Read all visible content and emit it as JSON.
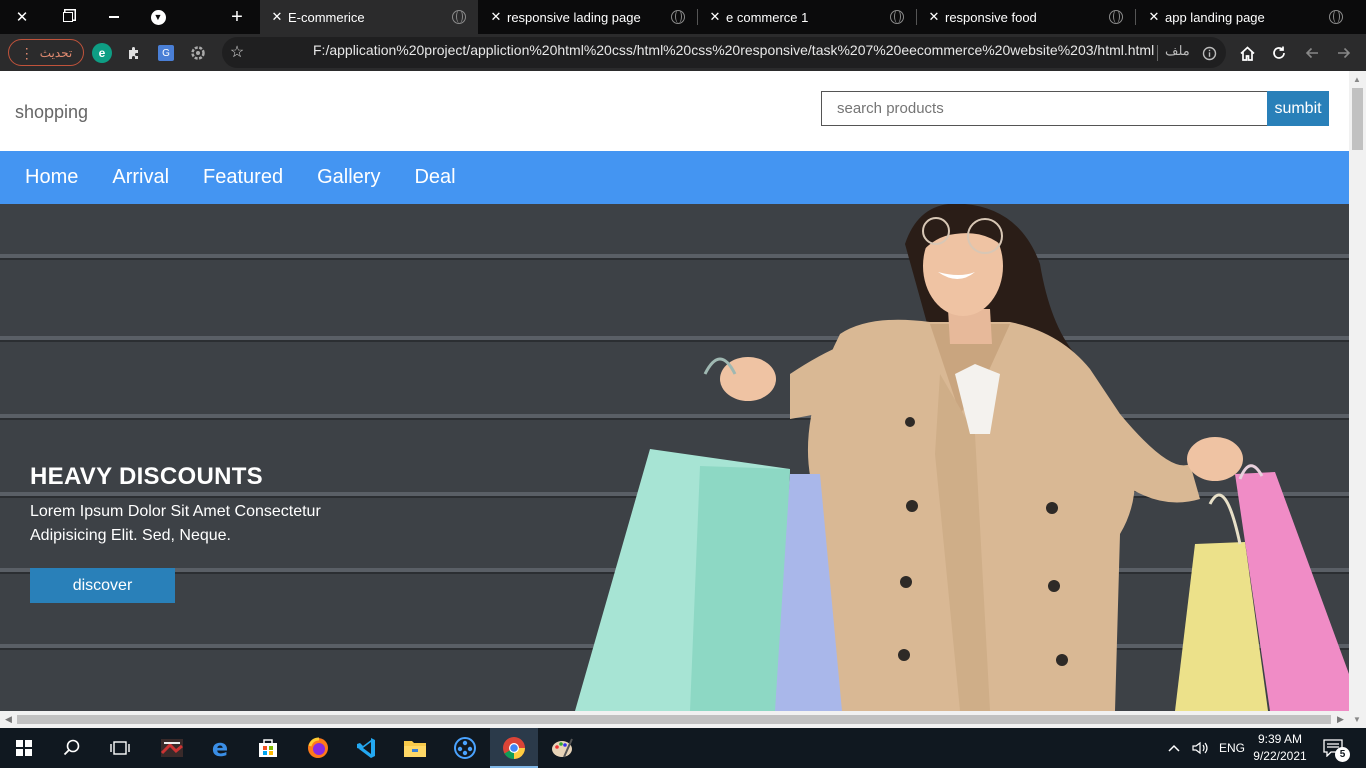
{
  "browser": {
    "tabs": [
      {
        "label": "E-commerice",
        "active": true
      },
      {
        "label": "responsive lading page",
        "active": false
      },
      {
        "label": "e commerce 1",
        "active": false
      },
      {
        "label": "responsive food",
        "active": false
      },
      {
        "label": "app landing page",
        "active": false
      }
    ],
    "update_label": "تحديث",
    "url": "F:/application%20project/appliction%20html%20css/html%20css%20responsive/task%207%20eecommerce%20website%203/html.html",
    "url_scheme_label": "ملف",
    "extension_e_letter": "e",
    "extension_g_letter": "G"
  },
  "site": {
    "logo": "shopping",
    "search_placeholder": "search products",
    "search_button": "sumbit",
    "nav": [
      "Home",
      "Arrival",
      "Featured",
      "Gallery",
      "Deal"
    ],
    "hero": {
      "title": "HEAVY DISCOUNTS",
      "text": "Lorem Ipsum Dolor Sit Amet Consectetur Adipisicing Elit. Sed, Neque.",
      "button": "discover"
    }
  },
  "taskbar": {
    "language": "ENG",
    "time": "9:39 AM",
    "date": "9/22/2021",
    "notification_count": "5"
  },
  "colors": {
    "nav_bg": "#4495f2",
    "button_bg": "#2980b9",
    "hero_bg": "#3d4146"
  }
}
